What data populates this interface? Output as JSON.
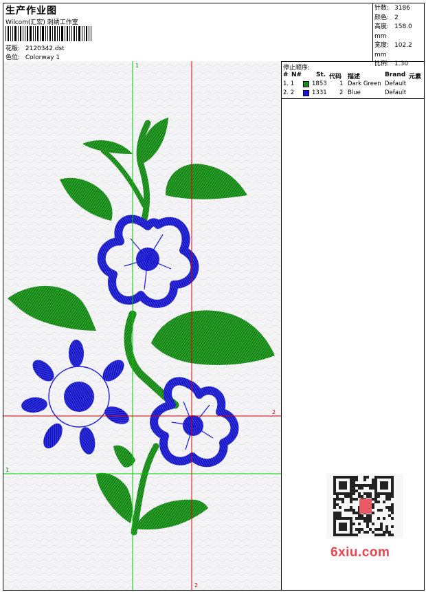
{
  "header": {
    "title": "生产作业图",
    "company": "Wilcom(汇宏) 刺绣工作室",
    "design_label": "花版:",
    "design_file": "2120342.dst",
    "colorway_label": "色位:",
    "colorway": "Colorway 1"
  },
  "stats": [
    {
      "label": "针数:",
      "value": "3186"
    },
    {
      "label": "颜色:",
      "value": "2"
    },
    {
      "label": "高度:",
      "value": "158.0 mm"
    },
    {
      "label": "宽度:",
      "value": "102.2 mm"
    },
    {
      "label": "比例:",
      "value": "1.30"
    }
  ],
  "color_table": {
    "caption": "停止顺序:",
    "columns": [
      "#",
      "N#",
      "St.",
      "代码",
      "描述",
      "Brand",
      "元素"
    ],
    "rows": [
      {
        "num": "1. 1",
        "color": "#18911c",
        "stitches": "1853",
        "code": "1",
        "desc": "Dark Green",
        "brand": "Default"
      },
      {
        "num": "2. 2",
        "color": "#1616e0",
        "stitches": "1331",
        "code": "2",
        "desc": "Blue",
        "brand": "Default"
      }
    ]
  },
  "guides": {
    "v1_label": "1",
    "v2_label": "2",
    "h1_label": "1",
    "h2_label": "2",
    "green": "#00cc00",
    "red": "#d40000"
  },
  "watermark": {
    "brand": "6xiu.com",
    "qr_icon": "qr-code-icon"
  },
  "colors": {
    "leaf": "#1f9a1f",
    "thread_blue": "#1a1adb"
  }
}
